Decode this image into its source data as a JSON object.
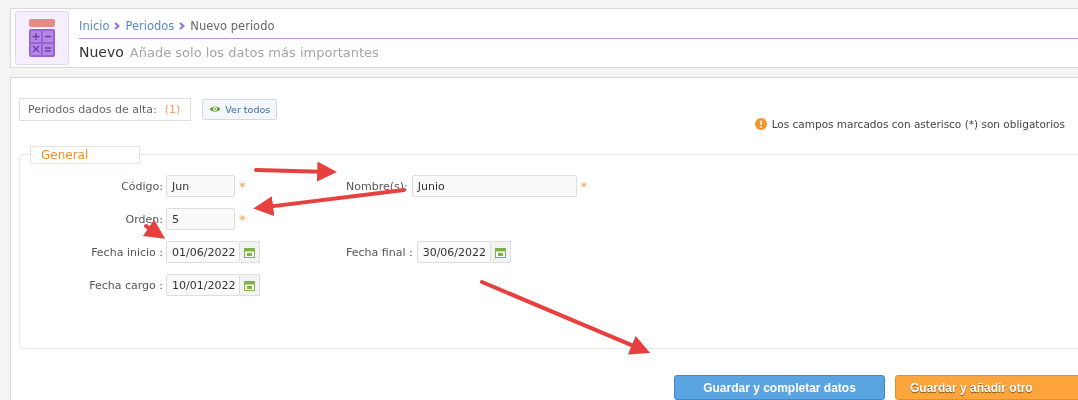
{
  "header": {
    "breadcrumb": [
      {
        "label": "Inicio",
        "link": true
      },
      {
        "label": "Periodos",
        "link": true
      },
      {
        "label": "Nuevo periodo",
        "link": false
      }
    ],
    "title": "Nuevo",
    "subtitle": "Añade solo los datos más importantes"
  },
  "toolbar": {
    "count_label": "Periodos dados de alta:",
    "count": "(1)",
    "view_all_button": "Ver todos",
    "notice": "Los campos marcados con asterisco (*) son obligatorios"
  },
  "fieldset": {
    "legend": "General",
    "rows": [
      [
        {
          "label": "Código:",
          "value": "Jun",
          "kind": "text",
          "mark": "*"
        },
        {
          "label": "Nombre(s):",
          "value": "Junio",
          "kind": "text",
          "mark": "*"
        }
      ],
      [
        {
          "label": "Orden:",
          "value": "5",
          "kind": "text",
          "mark": "*"
        }
      ],
      [
        {
          "label": "Fecha inicio :",
          "value": "01/06/2022",
          "kind": "date"
        },
        {
          "label": "Fecha final :",
          "value": "30/06/2022",
          "kind": "date"
        }
      ],
      [
        {
          "label": "Fecha cargo :",
          "value": "10/01/2022",
          "kind": "date"
        }
      ]
    ]
  },
  "buttons": [
    {
      "label": "Guardar y completar datos",
      "kind": "primary"
    },
    {
      "label": "Guardar y añadir otro",
      "kind": "secondary"
    }
  ]
}
